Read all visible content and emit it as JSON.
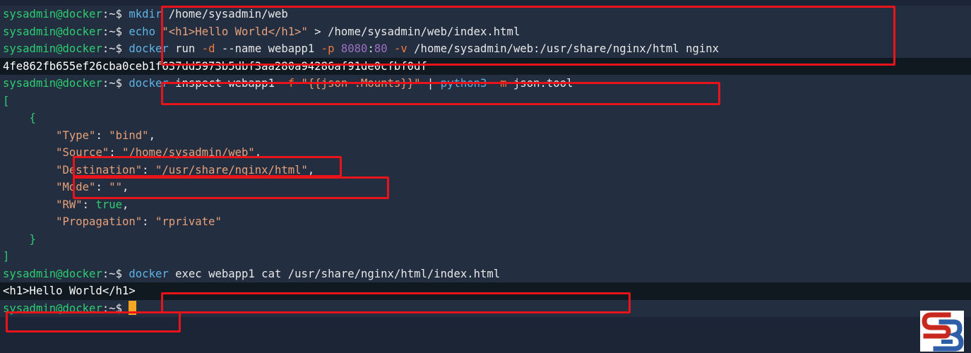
{
  "prompt": {
    "user": "sysadmin",
    "at": "@",
    "host": "docker",
    "path": ":~",
    "symbol": "$ "
  },
  "line1": {
    "cmd": "mkdir",
    "arg": " /home/sysadmin/web"
  },
  "line2": {
    "cmd": "echo",
    "sp": " ",
    "str": "\"<h1>Hello World</h1>\"",
    "rest": " > /home/sysadmin/web/index.html"
  },
  "line3": {
    "cmd": "docker",
    "a": " run ",
    "opt_d": "-d",
    "b": " --name webapp1 ",
    "opt_p": "-p",
    "sp": " ",
    "port_host": "8080",
    "port_sep": ":",
    "port_ctr": "80",
    "sp2": " ",
    "opt_v": "-v",
    "c": " /home/sysadmin/web:/usr/share/nginx/html nginx"
  },
  "line4": {
    "id": "4fe862fb655ef26cba0ceb1f637dd5973b5dbf3aa280a94286af91de0cfbf0df"
  },
  "line5": {
    "cmd": "docker",
    "a": " inspect webapp1 ",
    "opt_f": "-f",
    "sp": " ",
    "fmt": "\"{{json .Mounts}}\"",
    "pipe": " | ",
    "py": "python3",
    "sp2": " ",
    "opt_m": "-m",
    "tool": " json.tool"
  },
  "json": {
    "open_bracket": "[",
    "open_brace": "    {",
    "type_indent": "        ",
    "type_key": "\"Type\"",
    "type_colon": ": ",
    "type_val": "\"bind\"",
    "type_comma": ",",
    "src_key": "\"Source\"",
    "src_colon": ": ",
    "src_val": "\"/home/sysadmin/web\"",
    "src_comma": ",",
    "dst_key": "\"Destination\"",
    "dst_colon": ": ",
    "dst_val": "\"/usr/share/nginx/html\"",
    "dst_comma": ",",
    "mode_key": "\"Mode\"",
    "mode_colon": ": ",
    "mode_val": "\"\"",
    "mode_comma": ",",
    "rw_key": "\"RW\"",
    "rw_colon": ": ",
    "rw_val": "true",
    "rw_comma": ",",
    "prop_key": "\"Propagation\"",
    "prop_colon": ": ",
    "prop_val": "\"rprivate\"",
    "close_brace": "    }",
    "close_bracket": "]"
  },
  "line16": {
    "cmd": "docker",
    "rest": " exec webapp1 cat /usr/share/nginx/html/index.html"
  },
  "line17": {
    "output": "<h1>Hello World</h1>"
  },
  "colors": {
    "background": "#1b2535",
    "highlight_box": "#e8141a",
    "prompt_user": "#2ecc71",
    "command": "#5fb3e6",
    "cursor": "#f5a623"
  },
  "icons": {
    "logo": "sb-logo-icon"
  }
}
